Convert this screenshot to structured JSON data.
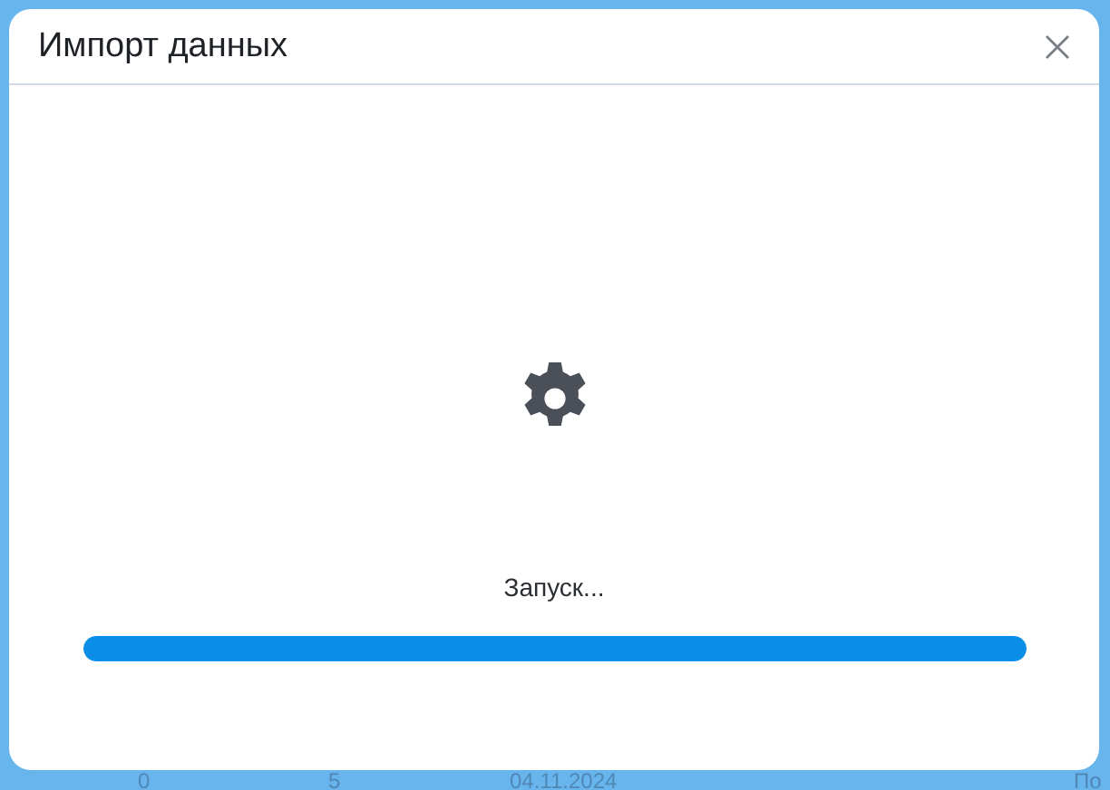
{
  "dialog": {
    "title": "Импорт данных",
    "status": "Запуск...",
    "progress": {
      "level": 1
    }
  },
  "background_row": {
    "cells": [
      "0",
      "5",
      "04.11.2024",
      "По"
    ]
  }
}
